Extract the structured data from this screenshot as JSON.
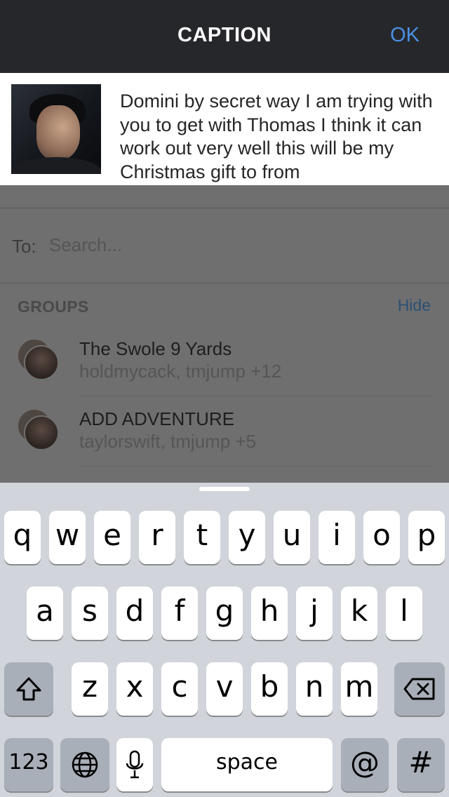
{
  "header": {
    "title": "CAPTION",
    "ok_label": "OK"
  },
  "caption": {
    "text": "Domini by secret way I am trying with you to get with Thomas I think it can work out very well this will be my Christmas gift to from"
  },
  "recipient": {
    "to_label": "To:",
    "placeholder": "Search..."
  },
  "groups": {
    "heading": "GROUPS",
    "hide_label": "Hide",
    "items": [
      {
        "name": "The Swole 9 Yards",
        "members": "holdmycack, tmjump +12"
      },
      {
        "name": "ADD ADVENTURE",
        "members": "taylorswift, tmjump +5"
      }
    ]
  },
  "keyboard": {
    "row1": [
      "q",
      "w",
      "e",
      "r",
      "t",
      "y",
      "u",
      "i",
      "o",
      "p"
    ],
    "row2": [
      "a",
      "s",
      "d",
      "f",
      "g",
      "h",
      "j",
      "k",
      "l"
    ],
    "row3": [
      "z",
      "x",
      "c",
      "v",
      "b",
      "n",
      "m"
    ],
    "numbers_label": "123",
    "space_label": "space",
    "at_label": "@",
    "hash_label": "#"
  },
  "colors": {
    "accent": "#4a90e2",
    "header_bg": "#26272b",
    "keyboard_bg": "#d1d4da"
  }
}
